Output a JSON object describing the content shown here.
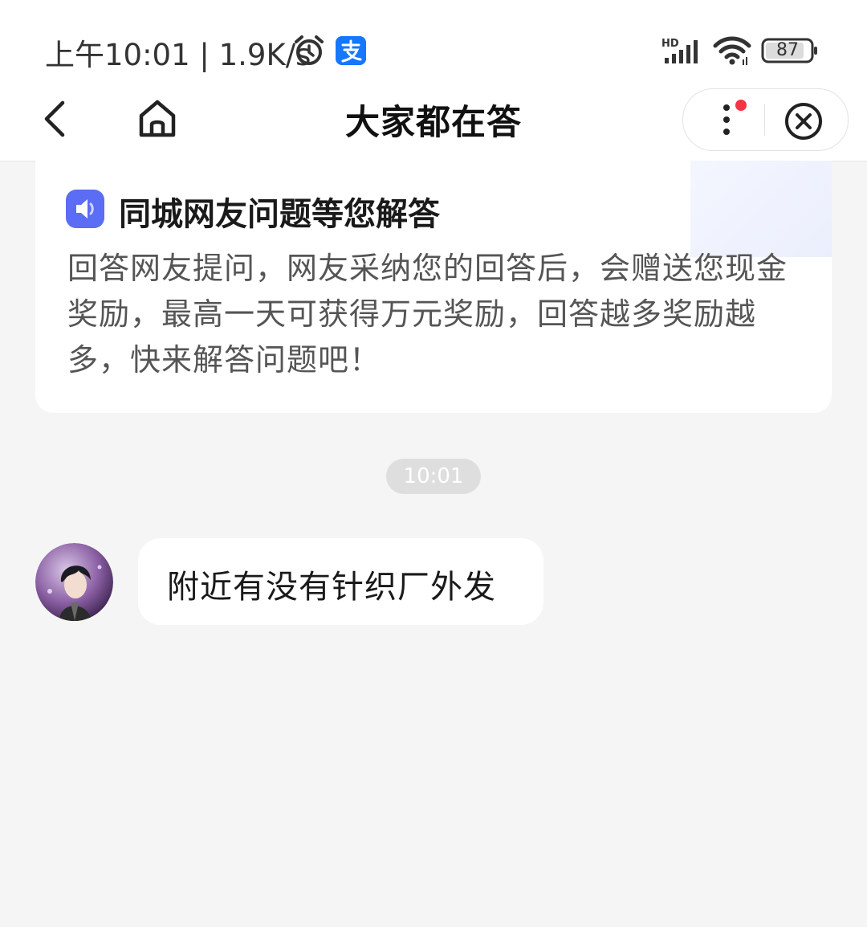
{
  "status_bar": {
    "time_speed": "上午10:01 | 1.9K/s",
    "network_badge": "HD",
    "battery": "87",
    "icons": [
      "alarm-icon",
      "alipay-icon",
      "signal-icon",
      "wifi-icon",
      "battery-icon"
    ]
  },
  "nav": {
    "title": "大家都在答",
    "icons": [
      "back-icon",
      "home-icon",
      "more-icon",
      "close-icon"
    ],
    "notification_dot_color": "#f23645"
  },
  "card": {
    "title": "同城网友问题等您解答",
    "body": "回答网友提问，网友采纳您的回答后，会赠送您现金奖励，最高一天可获得万元奖励，回答越多奖励越多，快来解答问题吧！"
  },
  "chat": {
    "timestamp": "10:01",
    "messages": [
      {
        "text": "附近有没有针织厂外发"
      }
    ]
  },
  "colors": {
    "page_background": "#f5f5f5",
    "accent": "#4d5cf0",
    "alipay_blue": "#1677ff"
  }
}
